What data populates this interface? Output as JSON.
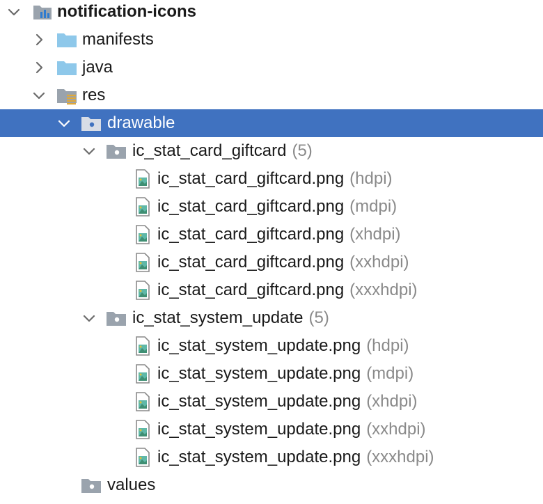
{
  "tree": {
    "root": {
      "label": "notification-icons"
    },
    "manifests": {
      "label": "manifests"
    },
    "java": {
      "label": "java"
    },
    "res": {
      "label": "res"
    },
    "drawable": {
      "label": "drawable"
    },
    "giftcard_group": {
      "label": "ic_stat_card_giftcard",
      "count": "(5)"
    },
    "giftcard_files": [
      {
        "name": "ic_stat_card_giftcard.png",
        "density": "(hdpi)"
      },
      {
        "name": "ic_stat_card_giftcard.png",
        "density": "(mdpi)"
      },
      {
        "name": "ic_stat_card_giftcard.png",
        "density": "(xhdpi)"
      },
      {
        "name": "ic_stat_card_giftcard.png",
        "density": "(xxhdpi)"
      },
      {
        "name": "ic_stat_card_giftcard.png",
        "density": "(xxxhdpi)"
      }
    ],
    "update_group": {
      "label": "ic_stat_system_update",
      "count": "(5)"
    },
    "update_files": [
      {
        "name": "ic_stat_system_update.png",
        "density": "(hdpi)"
      },
      {
        "name": "ic_stat_system_update.png",
        "density": "(mdpi)"
      },
      {
        "name": "ic_stat_system_update.png",
        "density": "(xhdpi)"
      },
      {
        "name": "ic_stat_system_update.png",
        "density": "(xxhdpi)"
      },
      {
        "name": "ic_stat_system_update.png",
        "density": "(xxxhdpi)"
      }
    ],
    "values": {
      "label": "values"
    }
  },
  "colors": {
    "selection": "#4072c0",
    "folder_blue": "#8ec8ea",
    "folder_gray": "#8a8a8a",
    "secondary_text": "#8a8a8a"
  }
}
